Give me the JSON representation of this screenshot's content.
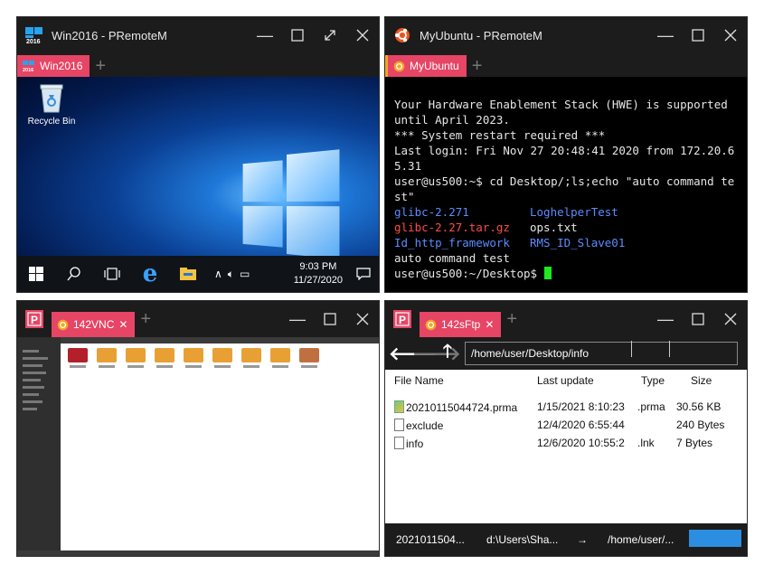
{
  "windows": {
    "win2016": {
      "title": "Win2016 - PRemoteM",
      "tab_label": "Win2016",
      "desktop": {
        "recycle_bin_label": "Recycle Bin",
        "clock_time": "9:03 PM",
        "clock_date": "11/27/2020"
      }
    },
    "ubuntu": {
      "title": "MyUbuntu - PRemoteM",
      "tab_label": "MyUbuntu",
      "terminal": {
        "lines": [
          "Your Hardware Enablement Stack (HWE) is supported until April 2023.",
          "*** System restart required ***",
          "Last login: Fri Nov 27 20:48:41 2020 from 172.20.65.31",
          "user@us500:~$ cd Desktop/;ls;echo \"auto command test\""
        ],
        "ls": [
          {
            "a": "glibc-2.271",
            "a_color": "blue",
            "b": "LoghelperTest",
            "b_color": "blue"
          },
          {
            "a": "glibc-2.27.tar.gz",
            "a_color": "red",
            "b": "ops.txt",
            "b_color": "white"
          },
          {
            "a": "Id_http_framework",
            "a_color": "blue",
            "b": "RMS_ID_Slave01",
            "b_color": "blue"
          }
        ],
        "echo_output": "auto command test",
        "prompt": "user@us500:~/Desktop$ "
      }
    },
    "vnc": {
      "tab_label": "142VNC"
    },
    "ftp": {
      "tab_label": "142sFtp",
      "path": "/home/user/Desktop/info",
      "columns": [
        "File Name",
        "Last update",
        "Type",
        "Size"
      ],
      "files": [
        {
          "name": "20210115044724.prma",
          "updated": "1/15/2021 8:10:23",
          "type": ".prma",
          "size": "30.56 KB",
          "icon": "image-file-icon"
        },
        {
          "name": "exclude",
          "updated": "12/4/2020 6:55:44",
          "type": "",
          "size": "240 Bytes",
          "icon": "file-icon"
        },
        {
          "name": "info",
          "updated": "12/6/2020 10:55:2",
          "type": ".lnk",
          "size": "7 Bytes",
          "icon": "file-icon"
        }
      ],
      "status": {
        "file": "2021011504...",
        "source": "d:\\Users\\Sha...",
        "arrow": "→",
        "dest": "/home/user/...",
        "progress": 1.0
      }
    }
  },
  "colors": {
    "tab_accent": "#e64565",
    "titlebar": "#1c1c1c",
    "progress": "#2c8ee0"
  }
}
